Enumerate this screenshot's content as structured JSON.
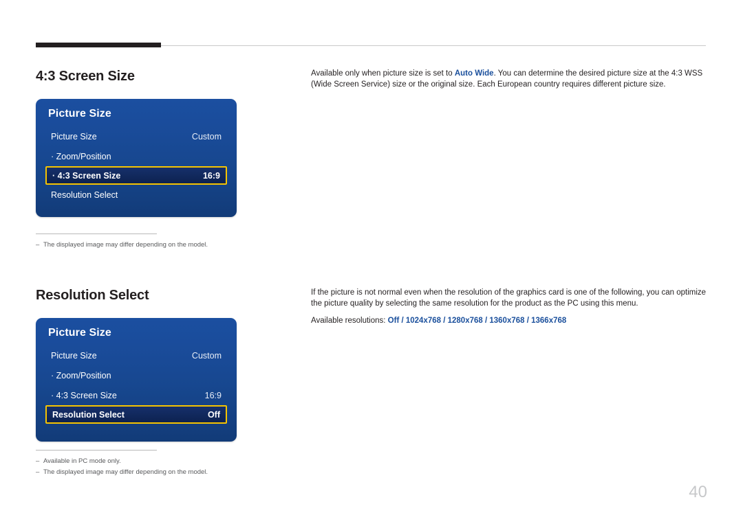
{
  "page": {
    "number": "40"
  },
  "sections": [
    {
      "title": "4:3 Screen Size",
      "description_prefix": "Available only when picture size is set to ",
      "description_bold": "Auto Wide",
      "description_suffix": ". You can determine the desired picture size at the 4:3 WSS (Wide Screen Service) size or the original size. Each European country requires different picture size.",
      "osd": {
        "header": "Picture Size",
        "rows": [
          {
            "label": "Picture Size",
            "value": "Custom",
            "selected": false
          },
          {
            "label": "· Zoom/Position",
            "value": "",
            "selected": false
          },
          {
            "label": "· 4:3 Screen Size",
            "value": "16:9",
            "selected": true
          },
          {
            "label": "Resolution Select",
            "value": "",
            "selected": false
          }
        ]
      },
      "notes": [
        "The displayed image may differ depending on the model."
      ]
    },
    {
      "title": "Resolution Select",
      "description": "If the picture is not normal even when the resolution of the graphics card is one of the following, you can optimize the picture quality by selecting the same resolution for the product as the PC using this menu.",
      "available_label": "Available resolutions: ",
      "available_values": "Off / 1024x768 / 1280x768 / 1360x768 / 1366x768",
      "osd": {
        "header": "Picture Size",
        "rows": [
          {
            "label": "Picture Size",
            "value": "Custom",
            "selected": false
          },
          {
            "label": "· Zoom/Position",
            "value": "",
            "selected": false
          },
          {
            "label": "· 4:3 Screen Size",
            "value": "16:9",
            "selected": false
          },
          {
            "label": "Resolution Select",
            "value": "Off",
            "selected": true
          }
        ]
      },
      "notes": [
        "Available in PC mode only.",
        "The displayed image may differ depending on the model."
      ]
    }
  ],
  "colors": {
    "accent_blue": "#1a4f9c",
    "osd_blue": "#17478f",
    "highlight_border": "#f6c400"
  }
}
